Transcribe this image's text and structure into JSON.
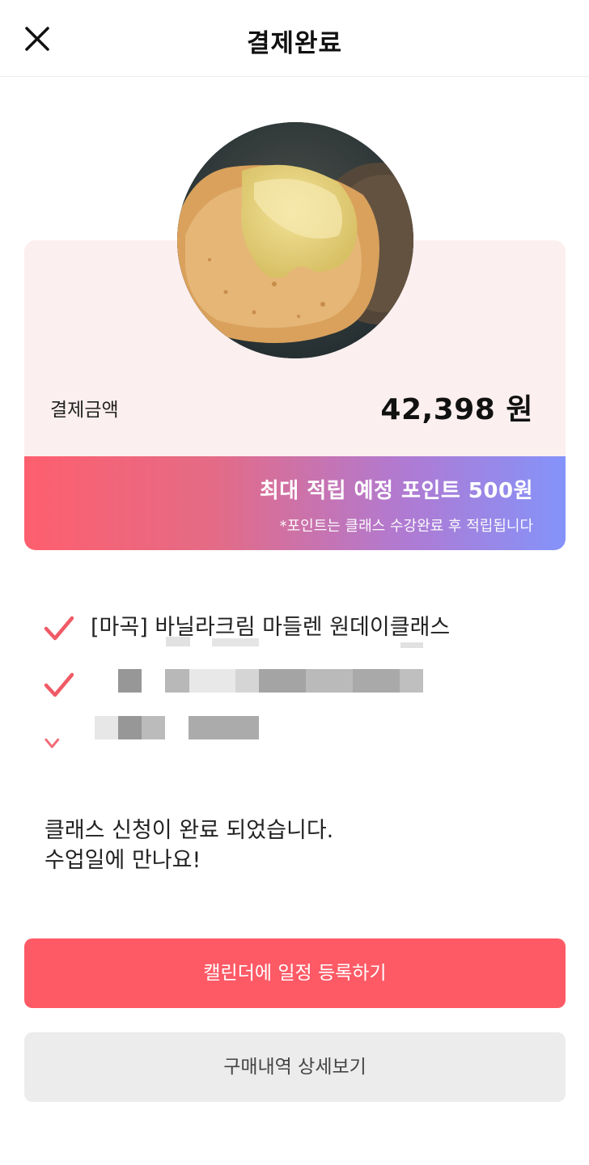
{
  "header": {
    "title": "결제완료",
    "close_icon": "close-icon"
  },
  "payment": {
    "amount_label": "결제금액",
    "amount_value": "42,398 원"
  },
  "points": {
    "main": "최대 적립 예정 포인트 500원",
    "note": "*포인트는 클래스 수강완료 후 적립됩니다"
  },
  "class_items": [
    {
      "icon": "check-icon",
      "text": "[마곡] 바닐라크림 마들렌 원데이클래스"
    }
  ],
  "message": {
    "line1": "클래스 신청이 완료 되었습니다.",
    "line2": "수업일에 만나요!"
  },
  "buttons": {
    "calendar": "캘린더에 일정 등록하기",
    "details": "구매내역 상세보기"
  },
  "colors": {
    "accent": "#fe5a66",
    "card_bg": "#fcefef",
    "gradient_start": "#fe5f6e",
    "gradient_end": "#8493fa",
    "secondary_button": "#ececec"
  }
}
